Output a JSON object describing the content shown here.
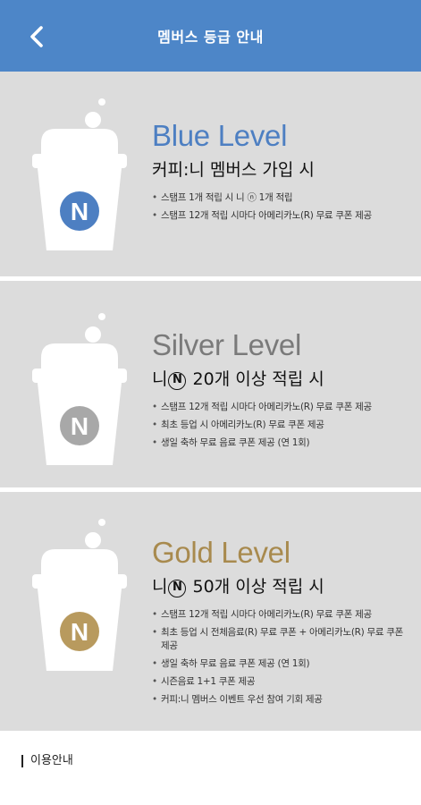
{
  "header": {
    "title": "멤버스 등급 안내"
  },
  "tiers": [
    {
      "title": "Blue Level",
      "color": "#4d7fc2",
      "condition": "커피:니 멤버스 가입 시",
      "benefits": [
        "스탬프 1개 적립 시 니 ⓝ 1개 적립",
        "스탬프 12개 적립 시마다 아메리카노(R) 무료 쿠폰 제공"
      ]
    },
    {
      "title": "Silver Level",
      "color": "#7a7a7a",
      "badge_color": "#a8a8a8",
      "condition_prefix": "니",
      "condition_badge": "N",
      "condition_suffix": "20개 이상 적립 시",
      "benefits": [
        "스탬프 12개 적립 시마다 아메리카노(R) 무료 쿠폰 제공",
        "최초 등업 시 아메리카노(R) 무료 쿠폰 제공",
        "생일 축하 무료 음료 쿠폰 제공 (연 1회)"
      ]
    },
    {
      "title": "Gold Level",
      "color": "#a88a4e",
      "badge_color": "#b89a5e",
      "condition_prefix": "니",
      "condition_badge": "N",
      "condition_suffix": "50개 이상 적립 시",
      "benefits": [
        "스탬프 12개 적립 시마다 아메리카노(R) 무료 쿠폰 제공",
        "최초 등업 시 전체음료(R) 무료 쿠폰 + 아메리카노(R) 무료 쿠폰 제공",
        "생일 축하 무료 음료 쿠폰 제공 (연 1회)",
        "시즌음료 1+1 쿠폰 제공",
        "커피:니 멤버스 이벤트 우선 참여 기회 제공"
      ]
    }
  ],
  "cup_badge_letter": "N",
  "footer": {
    "title": "이용안내"
  }
}
